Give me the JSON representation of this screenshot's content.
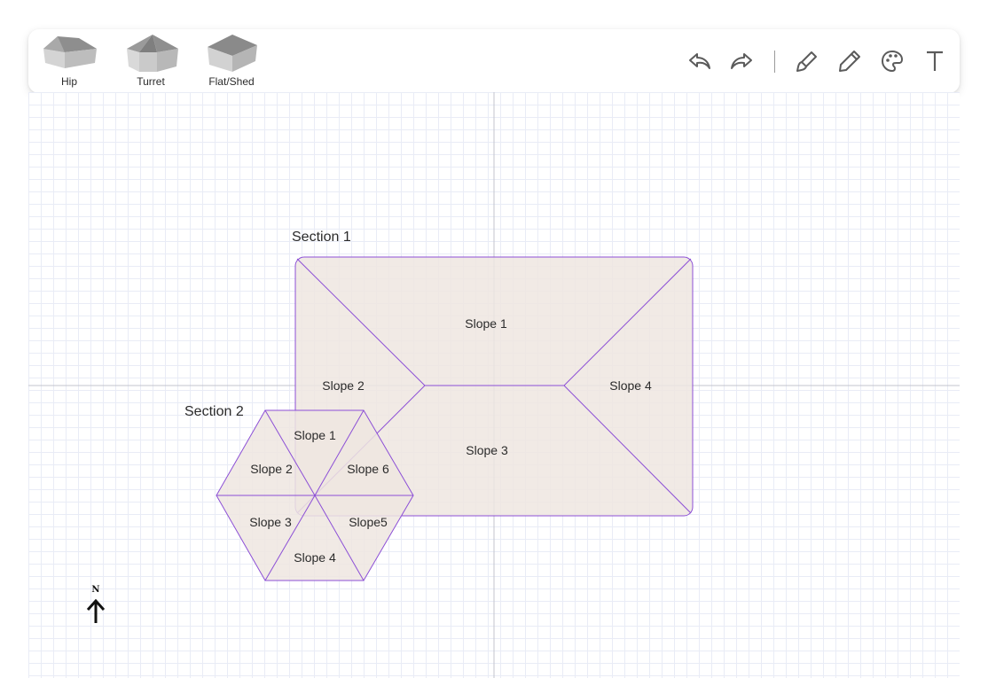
{
  "toolbar": {
    "shapes": [
      {
        "label": "Hip",
        "icon": "hip-roof-icon"
      },
      {
        "label": "Turret",
        "icon": "turret-roof-icon"
      },
      {
        "label": "Flat/Shed",
        "icon": "flat-shed-roof-icon"
      }
    ],
    "tools": [
      {
        "name": "undo",
        "icon": "undo-icon"
      },
      {
        "name": "redo",
        "icon": "redo-icon"
      },
      {
        "name": "brush",
        "icon": "brush-icon"
      },
      {
        "name": "pencil",
        "icon": "pencil-icon"
      },
      {
        "name": "palette",
        "icon": "palette-icon"
      },
      {
        "name": "text",
        "icon": "text-icon"
      }
    ]
  },
  "colors": {
    "outline": "#8c4fd6",
    "fill": "#efe6e1",
    "grid": "#e9ecf6",
    "axis": "#c3c5cc"
  },
  "sections": [
    {
      "label": "Section 1",
      "shape": "hip",
      "slopes": [
        "Slope 1",
        "Slope 2",
        "Slope 3",
        "Slope 4"
      ]
    },
    {
      "label": "Section 2",
      "shape": "turret",
      "slopes": [
        "Slope 1",
        "Slope 2",
        "Slope 3",
        "Slope 4",
        "Slope5",
        "Slope 6"
      ]
    }
  ],
  "compass": {
    "label": "N",
    "icon": "north-arrow-icon"
  }
}
